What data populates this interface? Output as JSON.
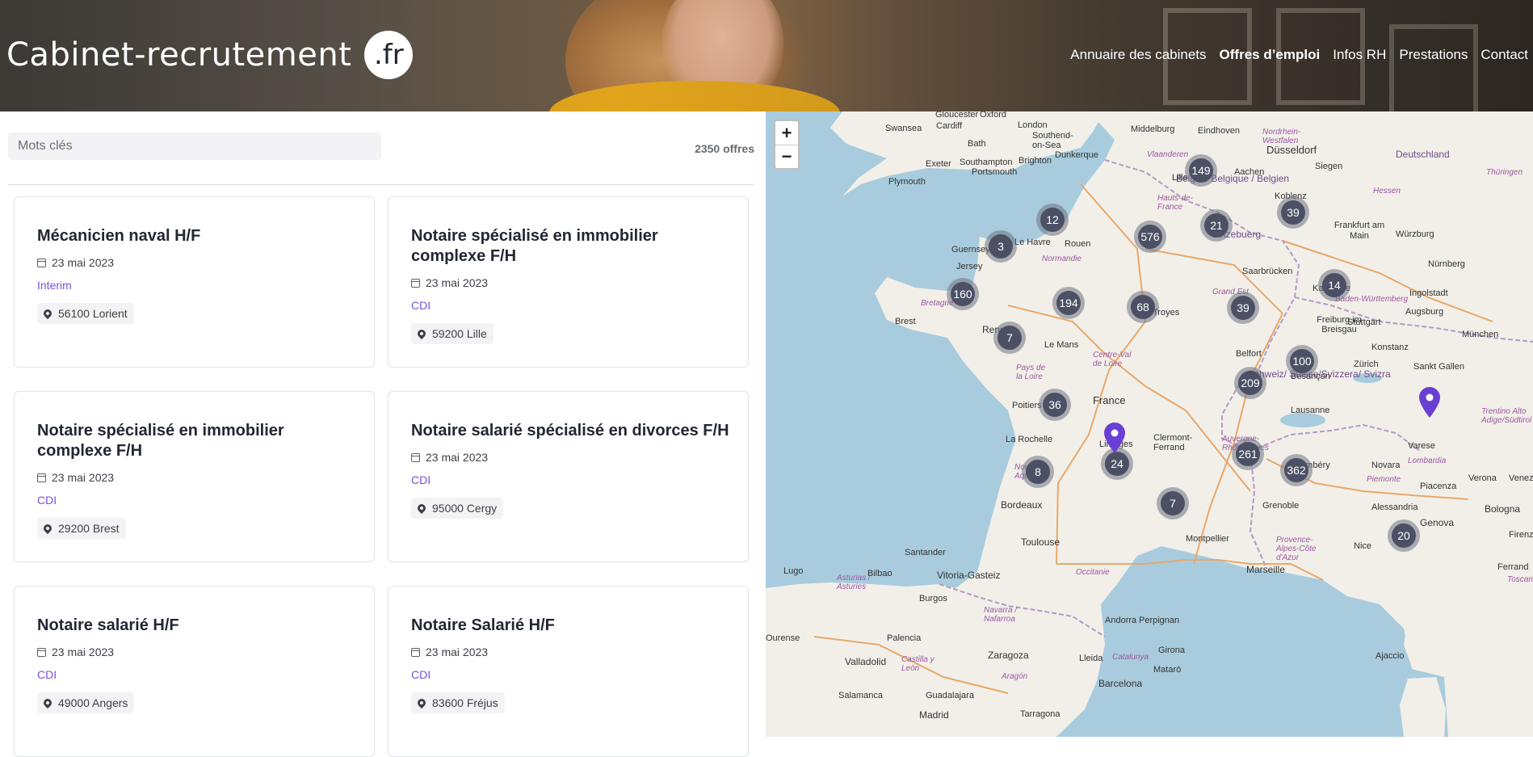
{
  "header": {
    "logo_text": "Cabinet-recrutement",
    "logo_badge": ".fr",
    "nav": [
      {
        "label": "Annuaire des cabinets",
        "active": false
      },
      {
        "label": "Offres d’emploi",
        "active": true
      },
      {
        "label": "Infos RH",
        "active": false
      },
      {
        "label": "Prestations",
        "active": false
      },
      {
        "label": "Contact",
        "active": false
      }
    ]
  },
  "search": {
    "placeholder": "Mots clés",
    "count": "2350 offres"
  },
  "jobs": [
    {
      "title": "Mécanicien naval H/F",
      "date": "23 mai 2023",
      "contract": "Interim",
      "location": "56100 Lorient"
    },
    {
      "title": "Notaire spécialisé en immobilier complexe F/H",
      "date": "23 mai 2023",
      "contract": "CDI",
      "location": "59200 Lille"
    },
    {
      "title": "Notaire spécialisé en immobilier complexe F/H",
      "date": "23 mai 2023",
      "contract": "CDI",
      "location": "29200 Brest"
    },
    {
      "title": "Notaire salarié spécialisé en divorces F/H",
      "date": "23 mai 2023",
      "contract": "CDI",
      "location": "95000 Cergy"
    },
    {
      "title": "Notaire salarié H/F",
      "date": "23 mai 2023",
      "contract": "CDI",
      "location": "49000 Angers"
    },
    {
      "title": "Notaire Salarié H/F",
      "date": "23 mai 2023",
      "contract": "CDI",
      "location": "83600 Fréjus"
    }
  ],
  "map": {
    "zoom_in": "+",
    "zoom_out": "−",
    "clusters": [
      "149",
      "12",
      "576",
      "21",
      "39",
      "3",
      "160",
      "194",
      "68",
      "39",
      "14",
      "7",
      "100",
      "209",
      "36",
      "8",
      "24",
      "261",
      "362",
      "7",
      "20"
    ],
    "cities": [
      "Gloucester",
      "Oxford",
      "London",
      "Swansea",
      "Cardiff",
      "Bath",
      "Southend-on-Sea",
      "Exeter",
      "Southampton",
      "Brighton",
      "Portsmouth",
      "Plymouth",
      "Dunkerque",
      "Middelburg",
      "Eindhoven",
      "Düsseldorf",
      "Lille",
      "Aachen",
      "Siegen",
      "Koblenz",
      "Frankfurt am Main",
      "Würzburg",
      "Nürnberg",
      "Guernsey",
      "Jersey",
      "Le Havre",
      "Rouen",
      "Saarbrücken",
      "Karlsruhe",
      "Ingolstadt",
      "Augsburg",
      "Brest",
      "Rennes",
      "Troyes",
      "Stuttgart",
      "Freiburg im Breisgau",
      "München",
      "Le Mans",
      "Belfort",
      "Konstanz",
      "Zürich",
      "Sankt Gallen",
      "Besançon",
      "Poitiers",
      "France",
      "Lausanne",
      "La Rochelle",
      "Limoges",
      "Clermont-Ferrand",
      "Chambéry",
      "Varese",
      "Novara",
      "Verona",
      "Venezia",
      "Piacenza",
      "Bordeaux",
      "Grenoble",
      "Alessandria",
      "Bologna",
      "Genova",
      "Toulouse",
      "Montpellier",
      "Nice",
      "Marseille",
      "Firenze",
      "Santander",
      "Bilbao",
      "Vitoria-Gasteiz",
      "Lugo",
      "Burgos",
      "Ourense",
      "Palencia",
      "Andorra",
      "Perpignan",
      "Ferrand",
      "Valladolid",
      "Zaragoza",
      "Lleida",
      "Girona",
      "Mataró",
      "Barcelona",
      "Ajaccio",
      "Salamanca",
      "Guadalajara",
      "Madrid",
      "Tarragona"
    ],
    "regions": [
      "Vlaanderen",
      "Hauts-de-France",
      "Normandie",
      "Bretagne",
      "Centre-Val de Loire",
      "Pays de la Loire",
      "Nouvelle-Aquitaine",
      "Auvergne-Rhône-Alpes",
      "Occitanie",
      "Provence-Alpes-Côte d'Azur",
      "Grand Est",
      "Baden-Württemberg",
      "Piemonte",
      "Lombardia",
      "Trentino Alto Adige/Südtirol",
      "Toscana",
      "Asturias / Asturies",
      "Navarra / Nafarroa",
      "Castilla y León",
      "Aragón",
      "Catalunya",
      "Hessen",
      "Thüringen",
      "Nordrhein-Westfalen"
    ],
    "countries": [
      "België / Belgique / Belgien",
      "Letzebuerg",
      "Deutschland",
      "Schweiz/ Suisse/Svizzera/ Svizra"
    ],
    "colors": {
      "land": "#f2efe9",
      "sea": "#a8ccdd",
      "cluster": "#4b5064",
      "marker": "#6a3fd6"
    }
  }
}
